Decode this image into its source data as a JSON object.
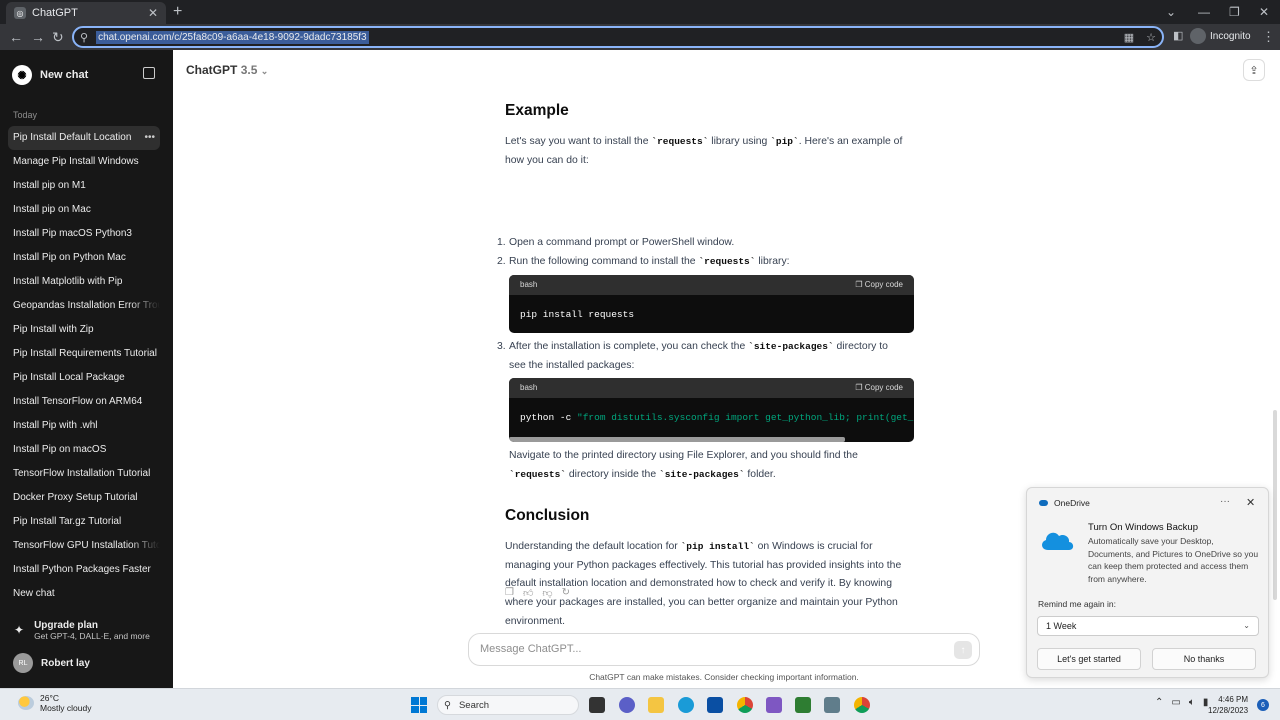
{
  "browser": {
    "tab_title": "ChatGPT",
    "new_tab": "+",
    "url": "chat.openai.com/c/25fa8c09-a6aa-4e18-9092-9dadc73185f3",
    "incognito": "Incognito"
  },
  "sidebar": {
    "new_chat": "New chat",
    "section": "Today",
    "items": [
      {
        "label": "Pip Install Default Location"
      },
      {
        "label": "Manage Pip Install Windows"
      },
      {
        "label": "Install pip on M1"
      },
      {
        "label": "Install pip on Mac"
      },
      {
        "label": "Install Pip macOS Python3"
      },
      {
        "label": "Install Pip on Python Mac"
      },
      {
        "label": "Install Matplotlib with Pip"
      },
      {
        "label": "Geopandas Installation Error Trou"
      },
      {
        "label": "Pip Install with Zip"
      },
      {
        "label": "Pip Install Requirements Tutorial"
      },
      {
        "label": "Pip Install Local Package"
      },
      {
        "label": "Install TensorFlow on ARM64"
      },
      {
        "label": "Install Pip with .whl"
      },
      {
        "label": "Install Pip on macOS"
      },
      {
        "label": "TensorFlow Installation Tutorial"
      },
      {
        "label": "Docker Proxy Setup Tutorial"
      },
      {
        "label": "Pip Install Tar.gz Tutorial"
      },
      {
        "label": "TensorFlow GPU Installation Tuto"
      },
      {
        "label": "Install Python Packages Faster"
      },
      {
        "label": "New chat"
      }
    ],
    "upgrade_title": "Upgrade plan",
    "upgrade_sub": "Get GPT-4, DALL·E, and more",
    "user_initials": "RL",
    "user_name": "Robert lay"
  },
  "header": {
    "model": "ChatGPT",
    "version": "3.5"
  },
  "content": {
    "example_heading": "Example",
    "example_intro": {
      "a": "Let's say you want to install the ",
      "c1": "`requests`",
      "b": " library using ",
      "c2": "`pip`",
      "c": ". Here's an example of",
      "d": "how you can do it:"
    },
    "step1": {
      "num": "1.",
      "text": "Open a command prompt or PowerShell window."
    },
    "step2": {
      "num": "2.",
      "a": "Run the following command to install the ",
      "c": "`requests`",
      "b": " library:"
    },
    "code1": {
      "lang": "bash",
      "copy": "Copy code",
      "code": "pip install requests"
    },
    "step3": {
      "num": "3.",
      "a": "After the installation is complete, you can check the ",
      "c": "`site-packages`",
      "b": " directory to",
      "d": "see the installed packages:"
    },
    "code2": {
      "lang": "bash",
      "copy": "Copy code",
      "cmd": "python -c ",
      "str": "\"from distutils.sysconfig import get_python_lib; print(get_p"
    },
    "navigate": {
      "a": "Navigate to the printed directory using File Explorer, and you should find the",
      "c1": "`requests`",
      "b": " directory inside the ",
      "c2": "`site-packages`",
      "d": " folder."
    },
    "conclusion_heading": "Conclusion",
    "conclusion": {
      "a": "Understanding the default location for ",
      "c": "`pip install`",
      "b": " on Windows is crucial for",
      "l2": "managing your Python packages effectively. This tutorial has provided insights into the",
      "l3": "default installation location and demonstrated how to check and verify it. By knowing",
      "l4": "where your packages are installed, you can better organize and maintain your Python",
      "l5": "environment."
    }
  },
  "composer": {
    "placeholder": "Message ChatGPT...",
    "disclaimer": "ChatGPT can make mistakes. Consider checking important information."
  },
  "toast": {
    "app": "OneDrive",
    "title": "Turn On Windows Backup",
    "body": "Automatically save your Desktop, Documents, and Pictures to OneDrive so you can keep them protected and access them from anywhere.",
    "remind_label": "Remind me again in:",
    "remind_value": "1 Week",
    "primary": "Let's get started",
    "secondary": "No thanks"
  },
  "taskbar": {
    "temp": "26°C",
    "condition": "Mostly cloudy",
    "search": "Search",
    "time": "4:46 PM",
    "date": "12/28/2023",
    "notifications": "6"
  },
  "colors": {
    "sidebar_bg": "#171717",
    "code_bg": "#0d0d0d",
    "code_string": "#00a67d",
    "accent_blue": "#0078d4"
  }
}
